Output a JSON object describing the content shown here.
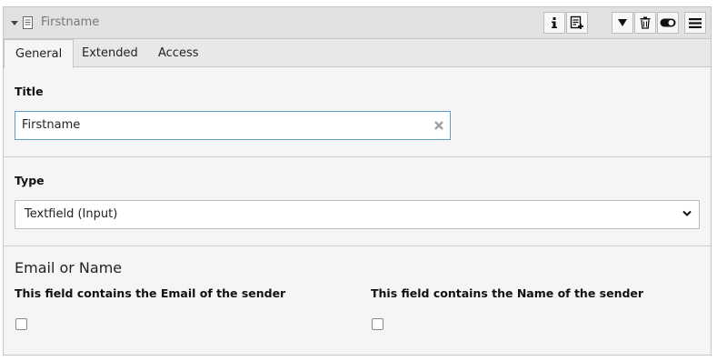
{
  "header": {
    "title": "Firstname",
    "icons": [
      "collapse-caret",
      "document-icon",
      "info-icon",
      "new-record-icon",
      "move-down-icon",
      "trash-icon",
      "toggle-icon",
      "menu-icon"
    ]
  },
  "tabs": [
    {
      "label": "General",
      "active": true
    },
    {
      "label": "Extended",
      "active": false
    },
    {
      "label": "Access",
      "active": false
    }
  ],
  "title_field": {
    "label": "Title",
    "value": "Firstname"
  },
  "type_field": {
    "label": "Type",
    "selected": "Textfield (Input)"
  },
  "email_or_name": {
    "heading": "Email or Name",
    "email_label": "This field contains the Email of the sender",
    "email_checked": false,
    "name_label": "This field contains the Name of the sender",
    "name_checked": false
  },
  "colors": {
    "header_bg": "#e1e1e1",
    "panel_bg": "#f5f5f5",
    "focus_border": "#5d9dca"
  }
}
